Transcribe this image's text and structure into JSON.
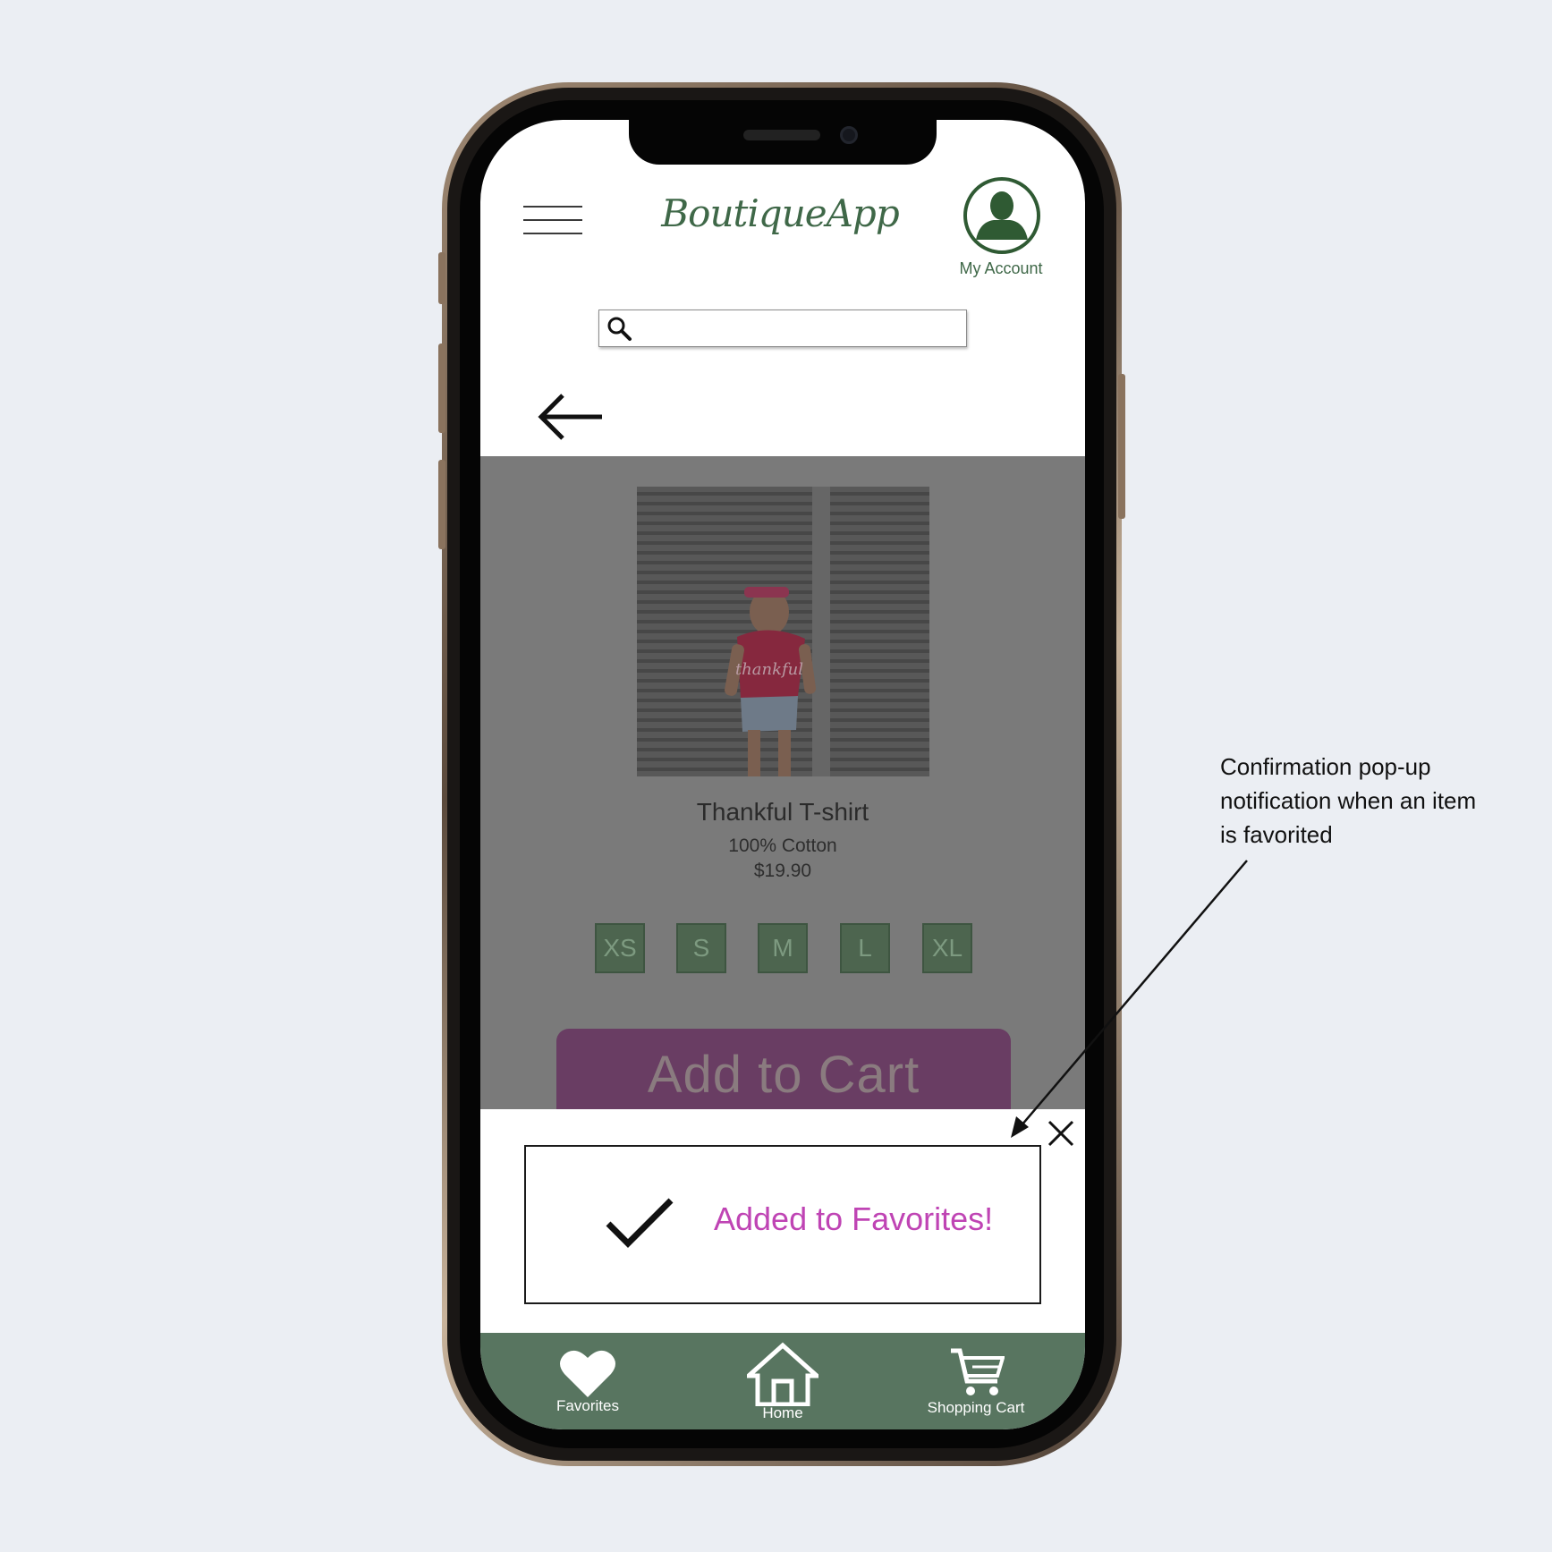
{
  "header": {
    "logo_text": "BoutiqueApp",
    "account_label": "My Account"
  },
  "search": {
    "placeholder": "",
    "value": ""
  },
  "product": {
    "name": "Thankful T-shirt",
    "material": "100% Cotton",
    "price": "$19.90",
    "image_text": "thankful",
    "sizes": [
      "XS",
      "S",
      "M",
      "L",
      "XL"
    ],
    "add_to_cart_label": "Add to Cart"
  },
  "popup": {
    "message": "Added to Favorites!",
    "icon": "check-icon",
    "close_icon": "close-icon"
  },
  "bottom_nav": {
    "items": [
      {
        "label": "Favorites",
        "icon": "heart-icon"
      },
      {
        "label": "Home",
        "icon": "home-icon"
      },
      {
        "label": "Shopping Cart",
        "icon": "cart-icon"
      }
    ]
  },
  "annotation": {
    "text": "Confirmation pop-up notification when an item is favorited"
  },
  "colors": {
    "brand_green": "#587560",
    "accent_purple": "#bf44b4",
    "cart_button": "#693d63",
    "overlay_gray": "#7a7a7a",
    "background": "#ebeef3"
  }
}
